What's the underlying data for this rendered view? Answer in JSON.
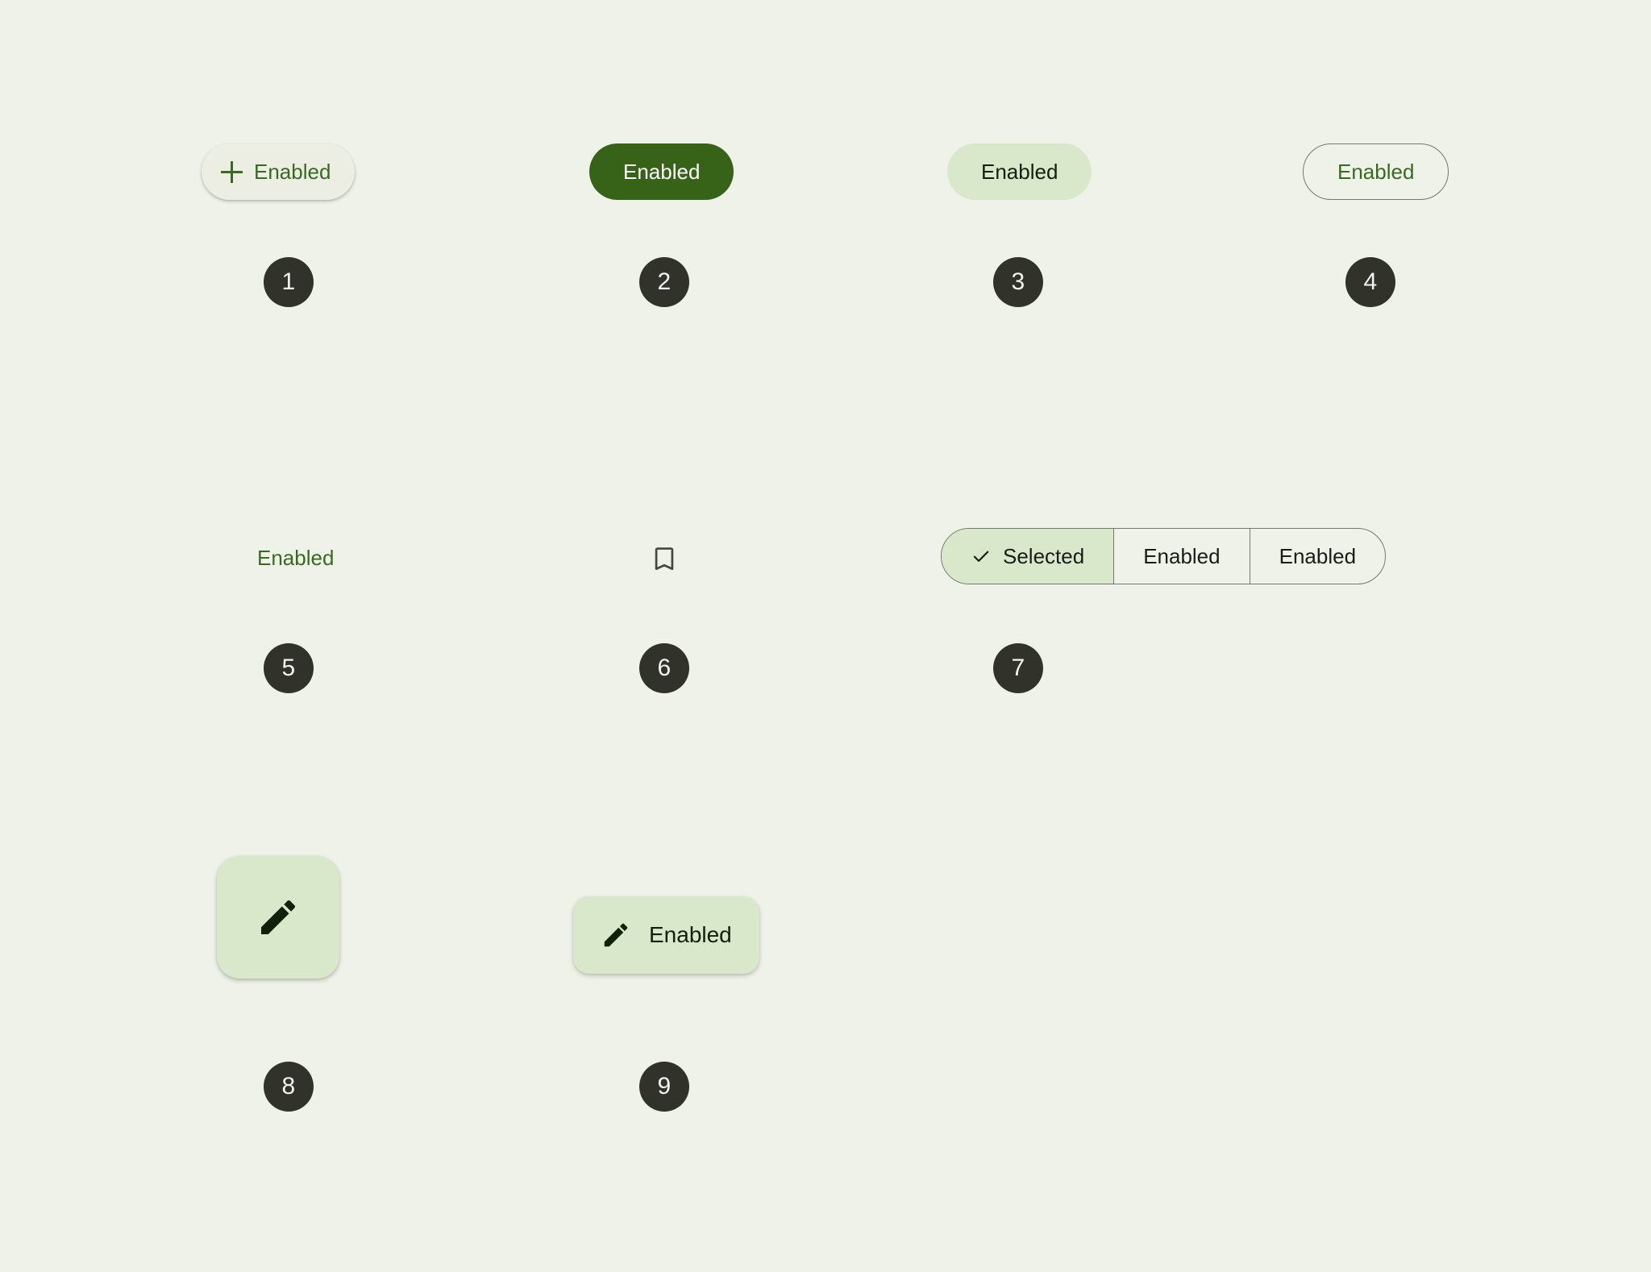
{
  "theme": {
    "background": "#eff2e8",
    "primary_green": "#376318",
    "label_green": "#386a20",
    "tonal_container": "#d9e7ca",
    "elevated_surface": "#eceee4",
    "outline": "#74796d",
    "on_surface": "#1a1c17",
    "badge_bg": "#31332b",
    "badge_text": "#f2f3ee"
  },
  "components": [
    {
      "number": "1",
      "type": "elevated-button",
      "label": "Enabled",
      "icon": "plus-icon"
    },
    {
      "number": "2",
      "type": "filled-button",
      "label": "Enabled",
      "icon": null
    },
    {
      "number": "3",
      "type": "filled-tonal-button",
      "label": "Enabled",
      "icon": null
    },
    {
      "number": "4",
      "type": "outlined-button",
      "label": "Enabled",
      "icon": null
    },
    {
      "number": "5",
      "type": "text-button",
      "label": "Enabled",
      "icon": null
    },
    {
      "number": "6",
      "type": "icon-button",
      "label": "",
      "icon": "bookmark-icon"
    },
    {
      "number": "7",
      "type": "segmented-button",
      "segments": [
        {
          "label": "Selected",
          "selected": true,
          "icon": "check-icon"
        },
        {
          "label": "Enabled",
          "selected": false,
          "icon": null
        },
        {
          "label": "Enabled",
          "selected": false,
          "icon": null
        }
      ]
    },
    {
      "number": "8",
      "type": "fab",
      "label": "",
      "icon": "pencil-icon"
    },
    {
      "number": "9",
      "type": "extended-fab",
      "label": "Enabled",
      "icon": "pencil-icon"
    }
  ]
}
